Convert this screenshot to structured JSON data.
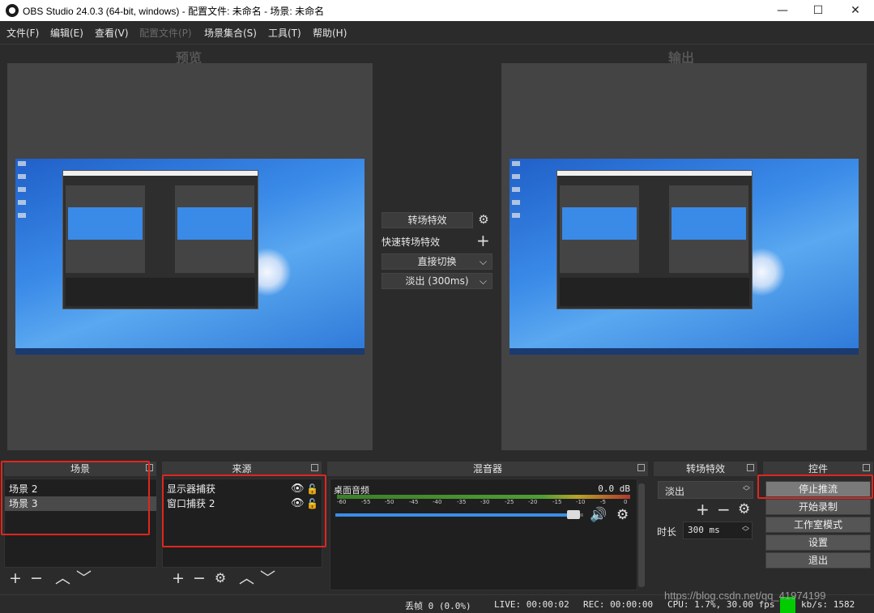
{
  "window": {
    "title": "OBS Studio 24.0.3 (64-bit, windows) - 配置文件: 未命名 - 场景: 未命名",
    "controls": {
      "minimize": "—",
      "maximize": "☐",
      "close": "✕"
    }
  },
  "menu": {
    "items": [
      {
        "label": "文件(F)"
      },
      {
        "label": "编辑(E)"
      },
      {
        "label": "查看(V)"
      },
      {
        "label": "配置文件(P)"
      },
      {
        "label": "场景集合(S)"
      },
      {
        "label": "工具(T)"
      },
      {
        "label": "帮助(H)"
      }
    ]
  },
  "preview": {
    "label": "预览"
  },
  "program": {
    "label": "输出"
  },
  "transition_center": {
    "transition_button": "转场特效",
    "quick_transitions": "快速转场特效",
    "items": [
      {
        "label": "直接切换"
      },
      {
        "label": "淡出 (300ms)"
      }
    ]
  },
  "docks": {
    "scenes": {
      "title": "场景",
      "items": [
        {
          "label": "场景 2",
          "selected": false
        },
        {
          "label": "场景 3",
          "selected": true
        }
      ]
    },
    "sources": {
      "title": "来源",
      "items": [
        {
          "label": "显示器捕获"
        },
        {
          "label": "窗口捕获 2"
        }
      ]
    },
    "mixer": {
      "title": "混音器",
      "channel": {
        "name": "桌面音频",
        "db": "0.0 dB"
      },
      "ticks": [
        "-60",
        "-55",
        "-50",
        "-45",
        "-40",
        "-35",
        "-30",
        "-25",
        "-20",
        "-15",
        "-10",
        "-5",
        "0"
      ],
      "volume_level": 0.98
    },
    "transitions": {
      "title": "转场特效",
      "selected": "淡出",
      "duration_label": "时长",
      "duration_value": "300 ms"
    },
    "controls": {
      "title": "控件",
      "buttons": [
        {
          "label": "停止推流",
          "active": true
        },
        {
          "label": "开始录制",
          "active": false
        },
        {
          "label": "工作室模式",
          "active": false
        },
        {
          "label": "设置",
          "active": false
        },
        {
          "label": "退出",
          "active": false
        }
      ]
    }
  },
  "status": {
    "dropped_frames": "丢帧 0 (0.0%)",
    "live": "LIVE: 00:00:02",
    "rec": "REC: 00:00:00",
    "cpu": "CPU: 1.7%, 30.00 fps",
    "kbps": "kb/s: 1582",
    "indicator_color": "#00cc00"
  },
  "watermark": "https://blog.csdn.net/qq_41974199",
  "colors": {
    "accent_red": "#e0261e",
    "volume_slider": "#3a8ee6"
  }
}
